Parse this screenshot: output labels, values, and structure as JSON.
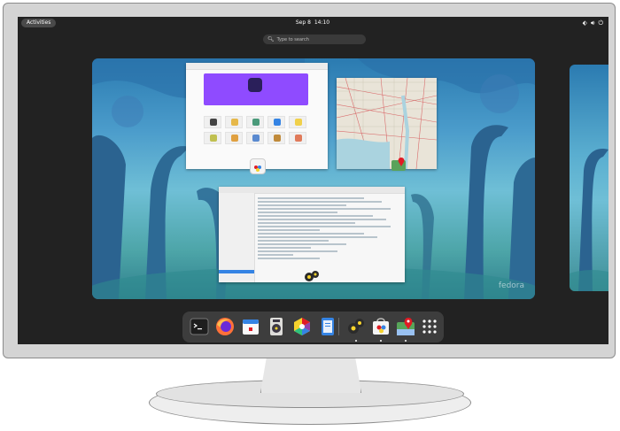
{
  "topbar": {
    "activities_label": "Activities",
    "date": "Sep 8",
    "time": "14:10"
  },
  "search": {
    "placeholder": "Type to search"
  },
  "workspace": {
    "watermark": "fedora"
  },
  "dash": {
    "apps": [
      {
        "name": "terminal-app",
        "icon": "terminal-icon",
        "running": false
      },
      {
        "name": "firefox-app",
        "icon": "firefox-icon",
        "running": false
      },
      {
        "name": "calendar-app",
        "icon": "calendar-icon",
        "running": false
      },
      {
        "name": "rhythmbox-app",
        "icon": "music-icon",
        "running": false
      },
      {
        "name": "photos-app",
        "icon": "photos-icon",
        "running": false
      },
      {
        "name": "text-editor-app",
        "icon": "text-editor-icon",
        "running": false
      },
      {
        "name": "builder-app",
        "icon": "gears-icon",
        "running": true
      },
      {
        "name": "software-app",
        "icon": "software-bag-icon",
        "running": true
      },
      {
        "name": "maps-app",
        "icon": "maps-icon",
        "running": true
      },
      {
        "name": "show-apps",
        "icon": "app-grid-icon",
        "running": false
      }
    ]
  },
  "colors": {
    "topbar_bg": "#222222",
    "dash_bg": "#3d3d3d",
    "accent": "#3584e4",
    "software_banner": "#8f4bff"
  }
}
